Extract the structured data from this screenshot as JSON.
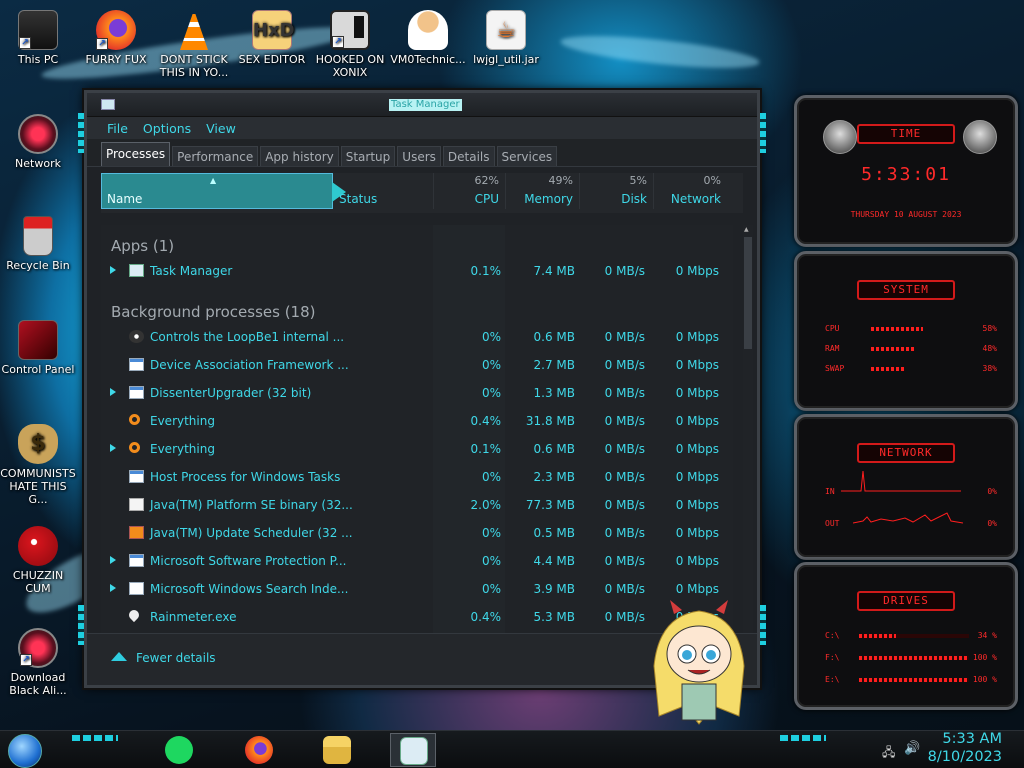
{
  "desktop": {
    "icons": [
      {
        "label": "This PC"
      },
      {
        "label": "FURRY FUX"
      },
      {
        "label": "DONT STICK THIS IN YO..."
      },
      {
        "label": "SEX EDITOR"
      },
      {
        "label": "HOOKED ON XONIX"
      },
      {
        "label": "VM0Technic..."
      },
      {
        "label": "lwjgl_util.jar"
      },
      {
        "label": "Network"
      },
      {
        "label": "Recycle Bin"
      },
      {
        "label": "Control Panel"
      },
      {
        "label": "COMMUNISTS HATE THIS G..."
      },
      {
        "label": "CHUZZIN CUM"
      },
      {
        "label": "Download Black Ali..."
      }
    ]
  },
  "taskmgr": {
    "title": "Task Manager",
    "menu": [
      "File",
      "Options",
      "View"
    ],
    "tabs": [
      "Processes",
      "Performance",
      "App history",
      "Startup",
      "Users",
      "Details",
      "Services"
    ],
    "columns": {
      "name": "Name",
      "status": "Status",
      "cpu": {
        "pct": "62%",
        "label": "CPU"
      },
      "memory": {
        "pct": "49%",
        "label": "Memory"
      },
      "disk": {
        "pct": "5%",
        "label": "Disk"
      },
      "network": {
        "pct": "0%",
        "label": "Network"
      }
    },
    "groups": {
      "apps": "Apps (1)",
      "background": "Background processes (18)"
    },
    "apps": [
      {
        "name": "Task Manager",
        "cpu": "0.1%",
        "mem": "7.4 MB",
        "disk": "0 MB/s",
        "net": "0 Mbps",
        "icon": "task-manager-icon",
        "expand": true
      }
    ],
    "background": [
      {
        "name": "Controls the LoopBe1 internal ...",
        "cpu": "0%",
        "mem": "0.6 MB",
        "disk": "0 MB/s",
        "net": "0 Mbps",
        "icon": "midi-icon",
        "expand": false
      },
      {
        "name": "Device Association Framework ...",
        "cpu": "0%",
        "mem": "2.7 MB",
        "disk": "0 MB/s",
        "net": "0 Mbps",
        "icon": "window-icon",
        "expand": false
      },
      {
        "name": "DissenterUpgrader (32 bit)",
        "cpu": "0%",
        "mem": "1.3 MB",
        "disk": "0 MB/s",
        "net": "0 Mbps",
        "icon": "window-icon",
        "expand": true
      },
      {
        "name": "Everything",
        "cpu": "0.4%",
        "mem": "31.8 MB",
        "disk": "0 MB/s",
        "net": "0 Mbps",
        "icon": "magnifier-icon",
        "expand": false
      },
      {
        "name": "Everything",
        "cpu": "0.1%",
        "mem": "0.6 MB",
        "disk": "0 MB/s",
        "net": "0 Mbps",
        "icon": "magnifier-icon",
        "expand": true
      },
      {
        "name": "Host Process for Windows Tasks",
        "cpu": "0%",
        "mem": "2.3 MB",
        "disk": "0 MB/s",
        "net": "0 Mbps",
        "icon": "window-icon",
        "expand": false
      },
      {
        "name": "Java(TM) Platform SE binary (32...",
        "cpu": "2.0%",
        "mem": "77.3 MB",
        "disk": "0 MB/s",
        "net": "0 Mbps",
        "icon": "java-icon",
        "expand": false
      },
      {
        "name": "Java(TM) Update Scheduler (32 ...",
        "cpu": "0%",
        "mem": "0.5 MB",
        "disk": "0 MB/s",
        "net": "0 Mbps",
        "icon": "java-update-icon",
        "expand": false
      },
      {
        "name": "Microsoft Software Protection P...",
        "cpu": "0%",
        "mem": "4.4 MB",
        "disk": "0 MB/s",
        "net": "0 Mbps",
        "icon": "window-icon",
        "expand": true
      },
      {
        "name": "Microsoft Windows Search Inde...",
        "cpu": "0%",
        "mem": "3.9 MB",
        "disk": "0 MB/s",
        "net": "0 Mbps",
        "icon": "search-indexer-icon",
        "expand": true
      },
      {
        "name": "Rainmeter.exe",
        "cpu": "0.4%",
        "mem": "5.3 MB",
        "disk": "0 MB/s",
        "net": "0 Mbps",
        "icon": "droplet-icon",
        "expand": false
      }
    ],
    "footer": "Fewer details"
  },
  "rainmeter": {
    "time": {
      "plate": "TIME",
      "clock": "5:33:01",
      "date": "THURSDAY 10 AUGUST 2023"
    },
    "system": {
      "plate": "SYSTEM",
      "rows": [
        {
          "label": "CPU",
          "value": "58%",
          "level": 0.58
        },
        {
          "label": "RAM",
          "value": "48%",
          "level": 0.48
        },
        {
          "label": "SWAP",
          "value": "38%",
          "level": 0.38
        }
      ]
    },
    "network": {
      "plate": "NETWORK",
      "rows": [
        {
          "label": "IN",
          "value": "0%"
        },
        {
          "label": "OUT",
          "value": "0%"
        }
      ]
    },
    "drives": {
      "plate": "DRIVES",
      "rows": [
        {
          "label": "C:\\",
          "value": "34 %",
          "level": 0.34
        },
        {
          "label": "F:\\",
          "value": "100 %",
          "level": 1.0
        },
        {
          "label": "E:\\",
          "value": "100 %",
          "level": 1.0
        }
      ]
    }
  },
  "taskbar": {
    "clock_time": "5:33 AM",
    "clock_date": "8/10/2023",
    "pinned": [
      "spotify-icon",
      "firefox-icon",
      "file-explorer-icon",
      "task-manager-icon"
    ]
  },
  "colors": {
    "accent": "#3fd8e8",
    "widget_red": "#ff2a2a",
    "window_bg": "#1f2226"
  }
}
